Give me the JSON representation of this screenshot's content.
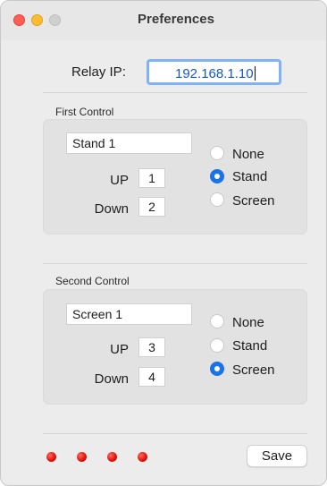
{
  "window": {
    "title": "Preferences"
  },
  "relay": {
    "label": "Relay IP:",
    "value": "192.168.1.10"
  },
  "first_control": {
    "title": "First Control",
    "name": "Stand 1",
    "up_label": "UP",
    "up_value": "1",
    "down_label": "Down",
    "down_value": "2",
    "options": [
      "None",
      "Stand",
      "Screen"
    ],
    "selected": "Stand"
  },
  "second_control": {
    "title": "Second Control",
    "name": "Screen 1",
    "up_label": "UP",
    "up_value": "3",
    "down_label": "Down",
    "down_value": "4",
    "options": [
      "None",
      "Stand",
      "Screen"
    ],
    "selected": "Screen"
  },
  "footer": {
    "indicators": [
      "red-led",
      "red-led",
      "red-led",
      "red-led"
    ],
    "save_label": "Save"
  },
  "colors": {
    "accent": "#1a73e8",
    "led": "#e3140f"
  }
}
